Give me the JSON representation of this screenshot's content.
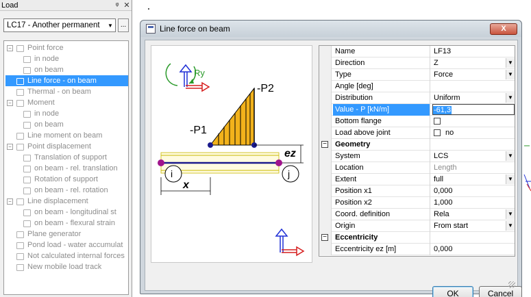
{
  "load_panel": {
    "title": "Load",
    "pin_icon": "pin-icon",
    "close_icon": "close-icon",
    "load_case": "LC17 - Another permanent",
    "more_button": "...",
    "tree": [
      {
        "label": "Point force",
        "level": 0,
        "expander": "−"
      },
      {
        "label": "in node",
        "level": 1
      },
      {
        "label": "on beam",
        "level": 1
      },
      {
        "label": "Line force - on beam",
        "level": 0,
        "selected": true
      },
      {
        "label": "Thermal - on beam",
        "level": 0
      },
      {
        "label": "Moment",
        "level": 0,
        "expander": "−"
      },
      {
        "label": "in node",
        "level": 1
      },
      {
        "label": "on beam",
        "level": 1
      },
      {
        "label": "Line moment on beam",
        "level": 0
      },
      {
        "label": "Point displacement",
        "level": 0,
        "expander": "−"
      },
      {
        "label": "Translation of support",
        "level": 1
      },
      {
        "label": "on beam - rel. translation",
        "level": 1
      },
      {
        "label": "Rotation of support",
        "level": 1
      },
      {
        "label": "on beam - rel. rotation",
        "level": 1
      },
      {
        "label": "Line displacement",
        "level": 0,
        "expander": "−"
      },
      {
        "label": "on beam - longitudinal st",
        "level": 1
      },
      {
        "label": "on beam - flexural strain",
        "level": 1
      },
      {
        "label": "Plane generator",
        "level": 0
      },
      {
        "label": "Pond load - water accumulat",
        "level": 0
      },
      {
        "label": "Not calculated internal forces",
        "level": 0
      },
      {
        "label": "New mobile load track",
        "level": 0
      }
    ]
  },
  "dialog": {
    "title": "Line force on beam",
    "close_label": "X",
    "ok_label": "OK",
    "cancel_label": "Cancel",
    "diagram": {
      "ry_label": "Ry",
      "p1_label": "-P1",
      "p2_label": "-P2",
      "ez_label": "ez",
      "node_i": "i",
      "node_j": "j",
      "x_label": "x"
    },
    "properties": [
      {
        "name": "Name",
        "value": "LF13",
        "kind": "text"
      },
      {
        "name": "Direction",
        "value": "Z",
        "kind": "dropdown"
      },
      {
        "name": "Type",
        "value": "Force",
        "kind": "dropdown"
      },
      {
        "name": "Angle [deg]",
        "value": "",
        "kind": "text"
      },
      {
        "name": "Distribution",
        "value": "Uniform",
        "kind": "dropdown"
      },
      {
        "name": "Value - P [kN/m]",
        "value": "-61,3",
        "kind": "edit",
        "selected": true
      },
      {
        "name": "Bottom flange",
        "value": "",
        "kind": "checkbox"
      },
      {
        "name": "Load above joint",
        "value": "no",
        "kind": "checkbox"
      },
      {
        "name": "Geometry",
        "value": "",
        "kind": "group",
        "expander": "−"
      },
      {
        "name": "System",
        "value": "LCS",
        "kind": "dropdown"
      },
      {
        "name": "Location",
        "value": "Length",
        "kind": "muted"
      },
      {
        "name": "Extent",
        "value": "full",
        "kind": "dropdown"
      },
      {
        "name": "Position x1",
        "value": "0,000",
        "kind": "text"
      },
      {
        "name": "Position x2",
        "value": "1,000",
        "kind": "text"
      },
      {
        "name": "Coord. definition",
        "value": "Rela",
        "kind": "dropdown"
      },
      {
        "name": "Origin",
        "value": "From start",
        "kind": "dropdown"
      },
      {
        "name": "Eccentricity",
        "value": "",
        "kind": "group",
        "expander": "−"
      },
      {
        "name": "Eccentricity ez [m]",
        "value": "0,000",
        "kind": "text"
      }
    ]
  },
  "colors": {
    "selection": "#3399ff",
    "load_fill": "#f2b21b",
    "beam": "#1a1a8c",
    "node": "#a0148c",
    "axis_red": "#d61f1f",
    "axis_blue": "#1e2fd6",
    "ry_green": "#2a9a2a"
  }
}
